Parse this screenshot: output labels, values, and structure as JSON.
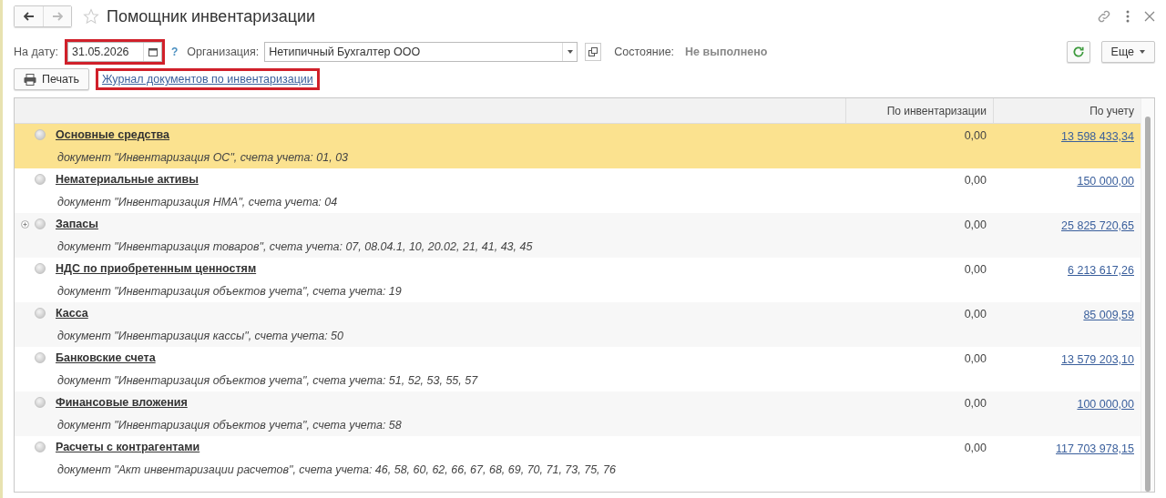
{
  "window": {
    "title": "Помощник инвентаризации",
    "favorite": false
  },
  "filters": {
    "date_label": "На дату:",
    "date_value": "31.05.2026",
    "date_highlighted": true,
    "help": "?",
    "org_label": "Организация:",
    "org_value": "Нетипичный Бухгалтер ООО",
    "state_label": "Состояние:",
    "state_value": "Не выполнено"
  },
  "toolbar": {
    "more_button": "Еще",
    "print_button": "Печать",
    "journal_link": "Журнал документов по инвентаризации",
    "journal_highlighted": true
  },
  "table": {
    "columns": [
      "По инвентаризации",
      "По учету"
    ],
    "rows": [
      {
        "name": "Основные средства",
        "description": "документ \"Инвентаризация ОС\", счета учета: 01, 03",
        "by_inventory": "0,00",
        "by_accounting": "13 598 433,34",
        "selected": true,
        "expandable": false
      },
      {
        "name": "Нематериальные активы",
        "description": "документ \"Инвентаризация НМА\", счета учета: 04",
        "by_inventory": "0,00",
        "by_accounting": "150 000,00",
        "selected": false,
        "expandable": false
      },
      {
        "name": "Запасы",
        "description": "документ \"Инвентаризация товаров\", счета учета: 07, 08.04.1, 10, 20.02, 21, 41, 43, 45",
        "by_inventory": "0,00",
        "by_accounting": "25 825 720,65",
        "selected": false,
        "expandable": true
      },
      {
        "name": "НДС по приобретенным ценностям",
        "description": "документ \"Инвентаризация объектов учета\", счета учета: 19",
        "by_inventory": "0,00",
        "by_accounting": "6 213 617,26",
        "selected": false,
        "expandable": false
      },
      {
        "name": "Касса",
        "description": "документ \"Инвентаризация кассы\", счета учета: 50",
        "by_inventory": "0,00",
        "by_accounting": "85 009,59",
        "selected": false,
        "expandable": false
      },
      {
        "name": "Банковские счета",
        "description": "документ \"Инвентаризация объектов учета\", счета учета: 51, 52, 53, 55, 57",
        "by_inventory": "0,00",
        "by_accounting": "13 579 203,10",
        "selected": false,
        "expandable": false
      },
      {
        "name": "Финансовые вложения",
        "description": "документ \"Инвентаризация объектов учета\", счета учета: 58",
        "by_inventory": "0,00",
        "by_accounting": "100 000,00",
        "selected": false,
        "expandable": false
      },
      {
        "name": "Расчеты с контрагентами",
        "description": "документ \"Акт инвентаризации расчетов\", счета учета: 46, 58, 60, 62, 66, 67, 68, 69, 70, 71, 73, 75, 76",
        "by_inventory": "0,00",
        "by_accounting": "117 703 978,15",
        "selected": false,
        "expandable": false
      }
    ]
  }
}
